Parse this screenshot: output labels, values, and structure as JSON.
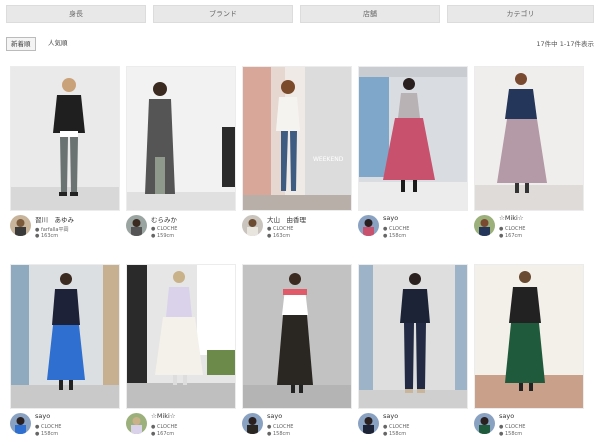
{
  "filters": {
    "tabs": [
      "身長",
      "ブランド",
      "店舗",
      "カテゴリ"
    ]
  },
  "sort": {
    "options": [
      "新着順",
      "人気順"
    ],
    "count_text": "17件中 1-17件表示"
  },
  "cards": [
    {
      "name": "習川　あゆみ",
      "brand": "● farfalla平岡",
      "height": "● 163cm"
    },
    {
      "name": "むらみか",
      "brand": "● CLOCHE",
      "height": "● 159cm"
    },
    {
      "name": "大山　由香理",
      "brand": "● CLOCHE",
      "height": "● 163cm"
    },
    {
      "name": "sayo",
      "brand": "● CLOCHE",
      "height": "● 158cm"
    },
    {
      "name": "☆Miki☆",
      "brand": "● CLOCHE",
      "height": "● 167cm"
    },
    {
      "name": "sayo",
      "brand": "● CLOCHE",
      "height": "● 158cm"
    },
    {
      "name": "☆Miki☆",
      "brand": "● CLOCHE",
      "height": "● 167cm"
    },
    {
      "name": "sayo",
      "brand": "● CLOCHE",
      "height": "● 158cm"
    },
    {
      "name": "sayo",
      "brand": "● CLOCHE",
      "height": "● 158cm"
    },
    {
      "name": "sayo",
      "brand": "● CLOCHE",
      "height": "● 158cm"
    }
  ]
}
